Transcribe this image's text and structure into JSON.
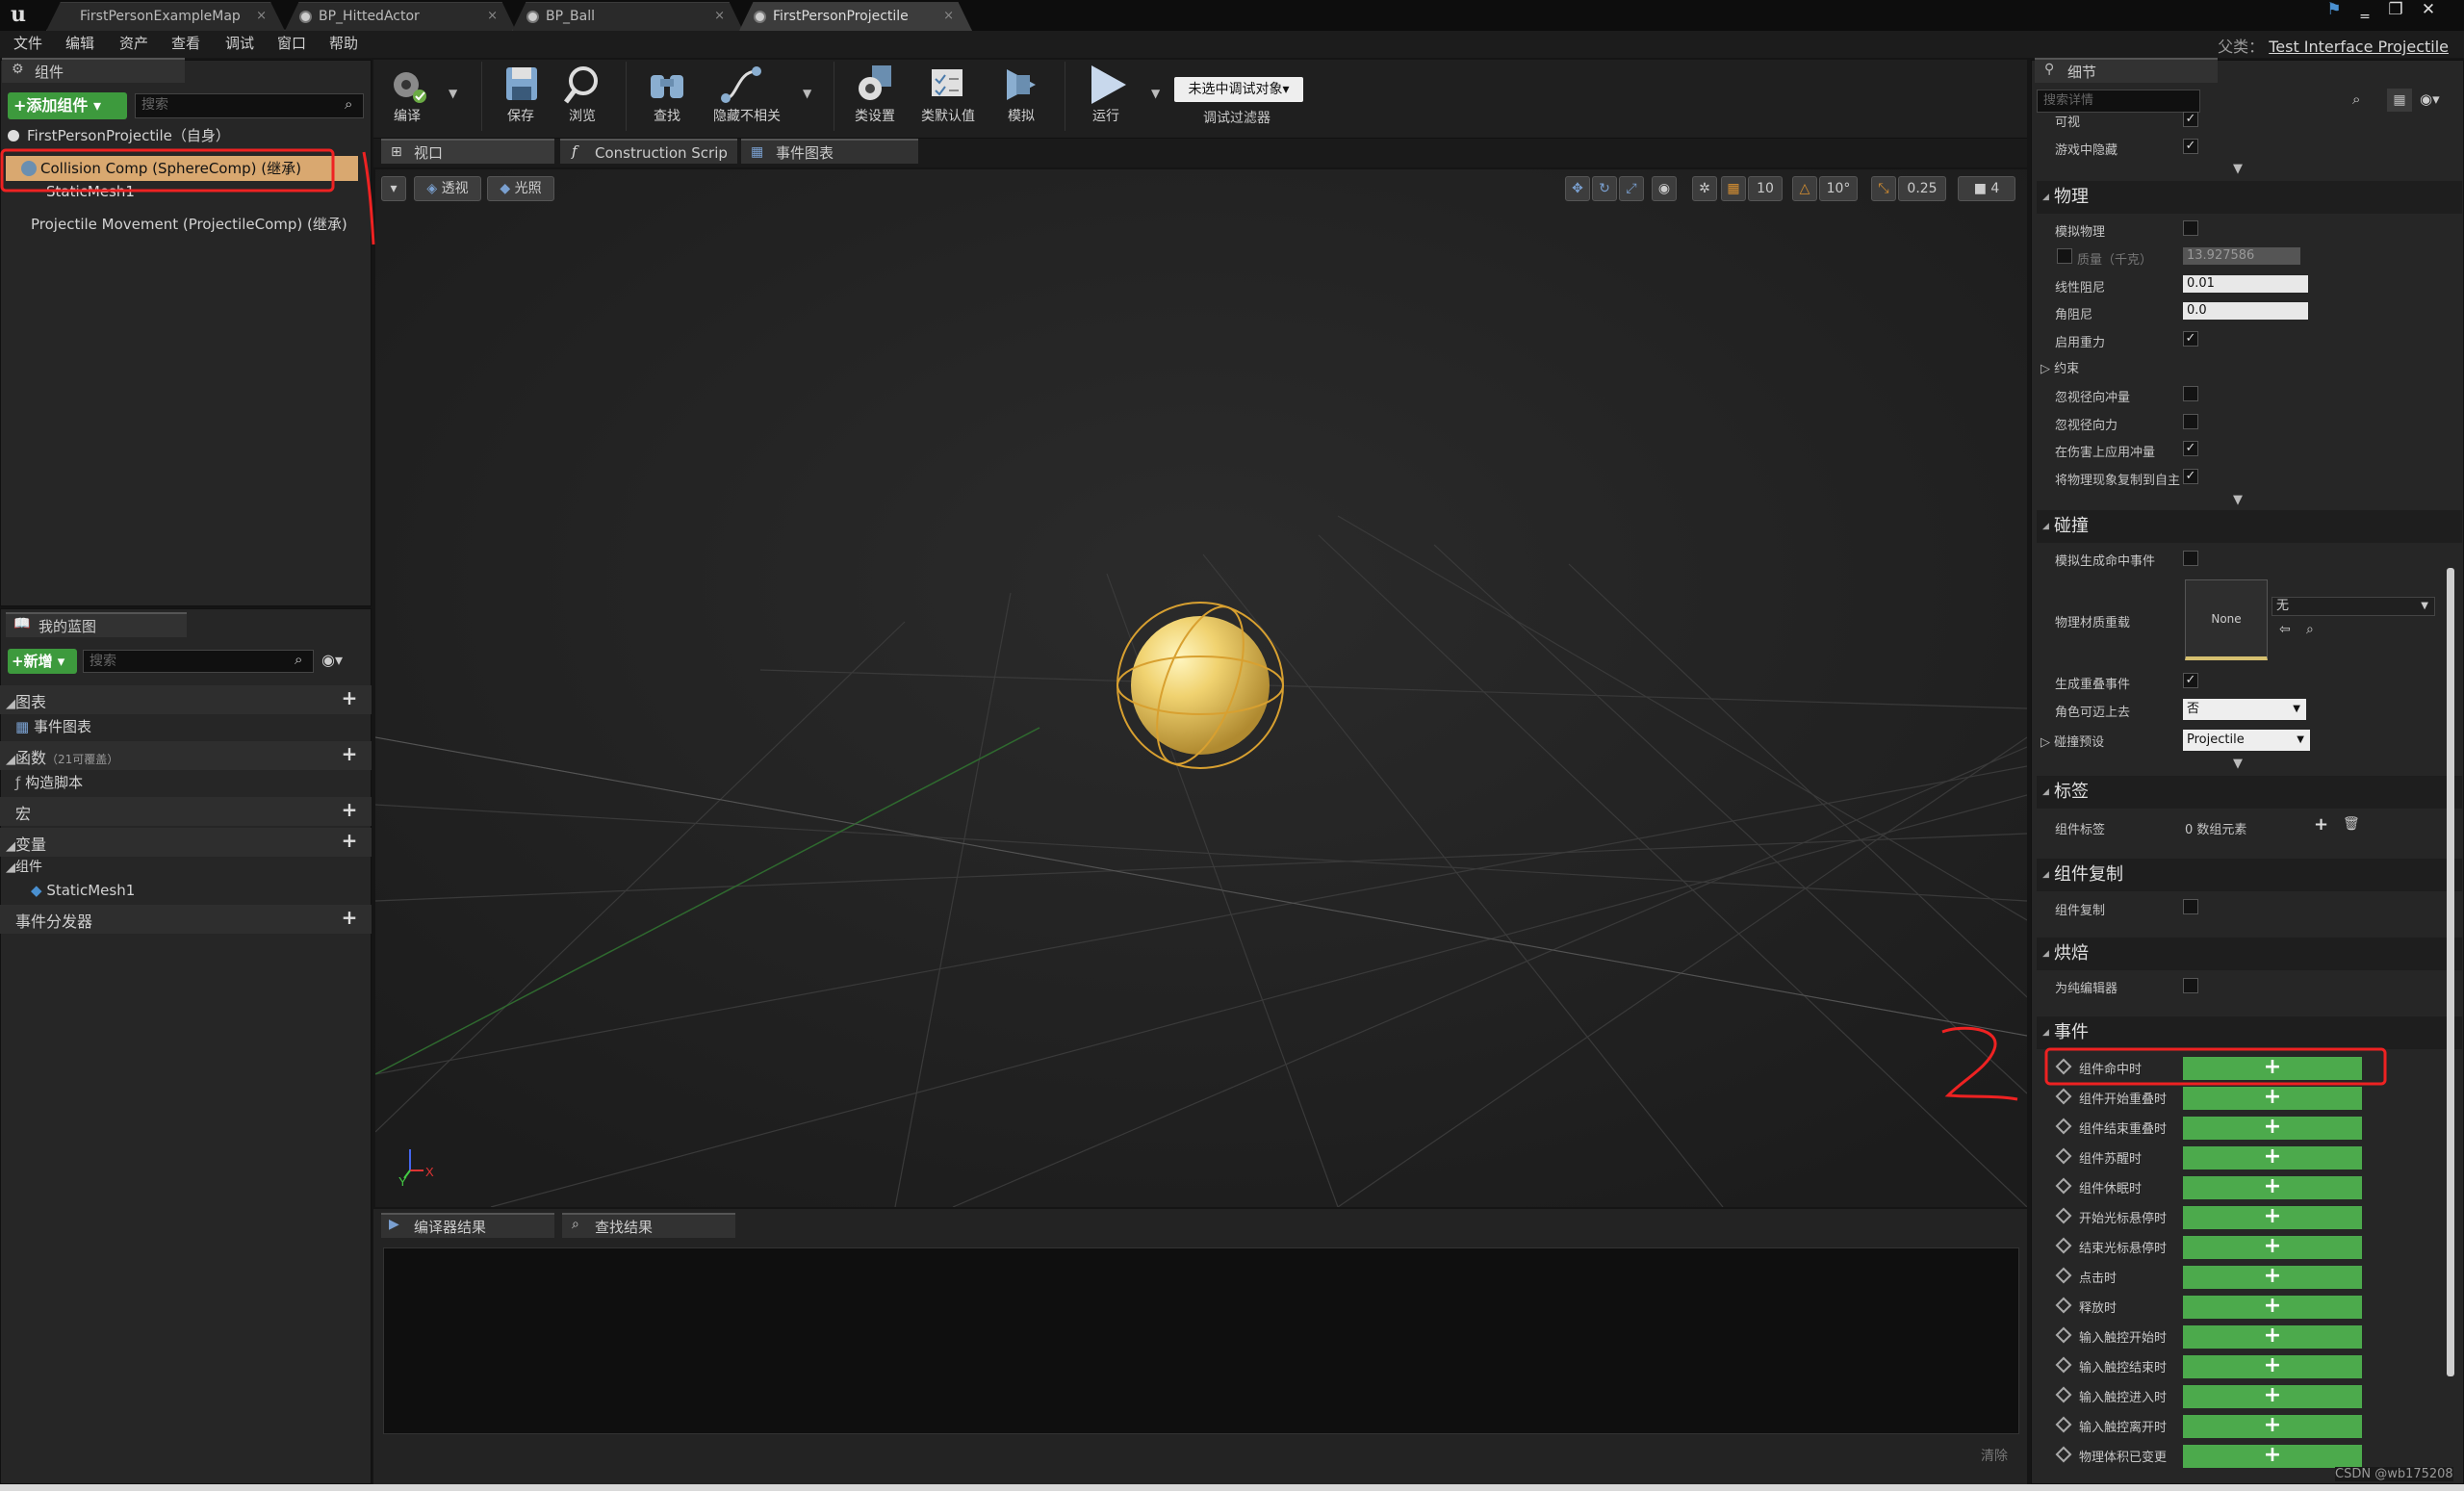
{
  "tabs": [
    {
      "label": "FirstPersonExampleMap",
      "active": false
    },
    {
      "label": "BP_HittedActor",
      "active": false
    },
    {
      "label": "BP_Ball",
      "active": false
    },
    {
      "label": "FirstPersonProjectile",
      "active": true
    }
  ],
  "menu": [
    "文件",
    "编辑",
    "资产",
    "查看",
    "调试",
    "窗口",
    "帮助"
  ],
  "parent_label": "父类：",
  "parent_class": "Test Interface Projectile",
  "components": {
    "tab": "组件",
    "add_button": "+添加组件 ▾",
    "search_placeholder": "搜索",
    "root": "FirstPersonProjectile（自身）",
    "items": [
      "Collision Comp (SphereComp) (继承)",
      "StaticMesh1",
      "Projectile Movement (ProjectileComp) (继承)"
    ]
  },
  "my_blueprint": {
    "tab": "我的蓝图",
    "new_button": "+新增 ▾",
    "search_placeholder": "搜索",
    "graphs": "图表",
    "event_graph": "事件图表",
    "functions": "函数",
    "functions_count": "（21可覆盖）",
    "construction": "构造脚本",
    "macros": "宏",
    "variables": "变量",
    "components": "组件",
    "static_mesh": "StaticMesh1",
    "dispatchers": "事件分发器"
  },
  "toolbar": {
    "compile": "编译",
    "save": "保存",
    "browse": "浏览",
    "find": "查找",
    "hide": "隐藏不相关",
    "class_settings": "类设置",
    "class_defaults": "类默认值",
    "simulate": "模拟",
    "play": "运行",
    "debug_dropdown": "未选中调试对象▾",
    "debug_filter": "调试过滤器"
  },
  "editor_tabs": [
    "视口",
    "Construction Scrip",
    "事件图表"
  ],
  "viewport": {
    "perspective": "透视",
    "lit": "光照",
    "grid": "10",
    "rotate": "10°",
    "scale": "0.25",
    "speed": "4"
  },
  "bottom_tabs": [
    "编译器结果",
    "查找结果"
  ],
  "clear": "清除",
  "details": {
    "tab": "细节",
    "search_placeholder": "搜索详情",
    "visible": "可视",
    "hidden_in_game": "游戏中隐藏",
    "physics": "物理",
    "simulate_physics": "模拟物理",
    "mass": "质量（千克）",
    "mass_value": "13.927586",
    "linear_damping": "线性阻尼",
    "linear_damping_value": "0.01",
    "angular_damping": "角阻尼",
    "angular_damping_value": "0.0",
    "enable_gravity": "启用重力",
    "constraints": "约束",
    "ignore_radial_impulse": "忽视径向冲量",
    "ignore_radial_force": "忽视径向力",
    "apply_impulse_on_damage": "在伤害上应用冲量",
    "replicate_physics": "将物理现象复制到自主",
    "collision": "碰撞",
    "sim_hit_events": "模拟生成命中事件",
    "phys_material": "物理材质重载",
    "none": "None",
    "none_dropdown": "无",
    "overlap_events": "生成重叠事件",
    "can_step_up": "角色可迈上去",
    "can_step_up_value": "否",
    "collision_presets": "碰撞预设",
    "collision_presets_value": "Projectile",
    "tags": "标签",
    "component_tags": "组件标签",
    "component_tags_value": "0 数组元素",
    "replication": "组件复制",
    "component_replicates": "组件复制",
    "cooking": "烘焙",
    "editor_only": "为纯编辑器",
    "events": "事件",
    "event_list": [
      "组件命中时",
      "组件开始重叠时",
      "组件结束重叠时",
      "组件苏醒时",
      "组件休眠时",
      "开始光标悬停时",
      "结束光标悬停时",
      "点击时",
      "释放时",
      "输入触控开始时",
      "输入触控结束时",
      "输入触控进入时",
      "输入触控离开时",
      "物理体积已变更"
    ]
  },
  "annotation_1": "1",
  "annotation_2": "2",
  "watermark": "CSDN @wb175208"
}
